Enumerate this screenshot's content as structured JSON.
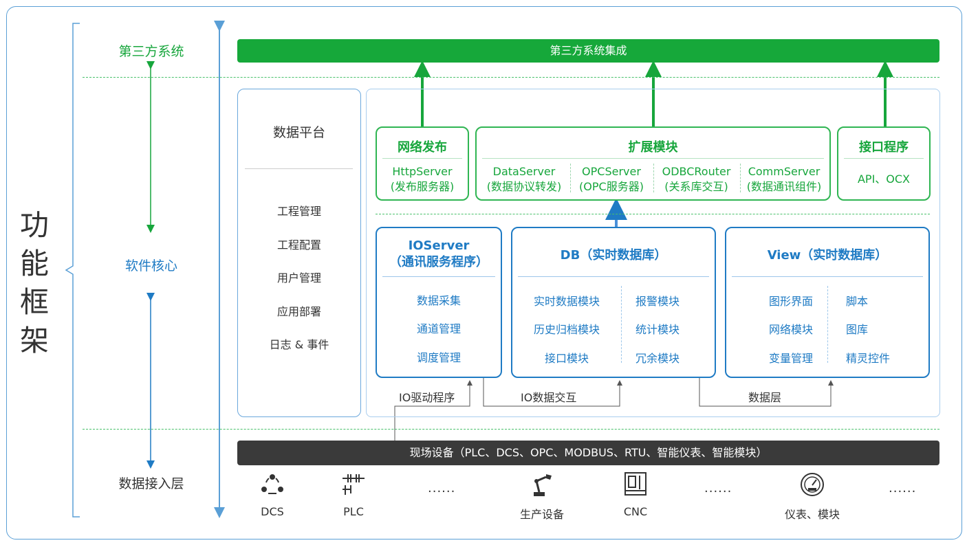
{
  "title": "功能框架",
  "layers": {
    "third_party": "第三方系统",
    "core": "软件核心",
    "access": "数据接入层"
  },
  "top_bar": "第三方系统集成",
  "platform": {
    "title": "数据平台",
    "items": [
      "工程管理",
      "工程配置",
      "用户管理",
      "应用部署",
      "日志 & 事件"
    ]
  },
  "publish": {
    "title": "网络发布",
    "line1": "HttpServer",
    "line2": "(发布服务器)"
  },
  "extension": {
    "title": "扩展模块",
    "items": [
      {
        "name": "DataServer",
        "desc": "(数据协议转发)"
      },
      {
        "name": "OPCServer",
        "desc": "(OPC服务器)"
      },
      {
        "name": "ODBCRouter",
        "desc": "(关系库交互)"
      },
      {
        "name": "CommServer",
        "desc": "(数据通讯组件)"
      }
    ]
  },
  "interface": {
    "title": "接口程序",
    "text": "API、OCX"
  },
  "ioserver": {
    "title1": "IOServer",
    "title2": "（通讯服务程序）",
    "items": [
      "数据采集",
      "通道管理",
      "调度管理"
    ]
  },
  "db": {
    "title": "DB（实时数据库）",
    "col1": [
      "实时数据模块",
      "历史归档模块",
      "接口模块"
    ],
    "col2": [
      "报警模块",
      "统计模块",
      "冗余模块"
    ]
  },
  "view": {
    "title": "View（实时数据库）",
    "col1": [
      "图形界面",
      "网络模块",
      "变量管理"
    ],
    "col2": [
      "脚本",
      "图库",
      "精灵控件"
    ]
  },
  "connectors": {
    "io_driver": "IO驱动程序",
    "io_exchange": "IO数据交互",
    "data_layer": "数据层"
  },
  "bottom_bar": "现场设备（PLC、DCS、OPC、MODBUS、RTU、智能仪表、智能模块）",
  "devices": {
    "dcs": "DCS",
    "plc": "PLC",
    "ellipsis": "......",
    "production": "生产设备",
    "cnc": "CNC",
    "meter": "仪表、模块"
  },
  "colors": {
    "green": "#16a83a",
    "blue": "#1f7bc4",
    "dark": "#3a3a3a"
  }
}
